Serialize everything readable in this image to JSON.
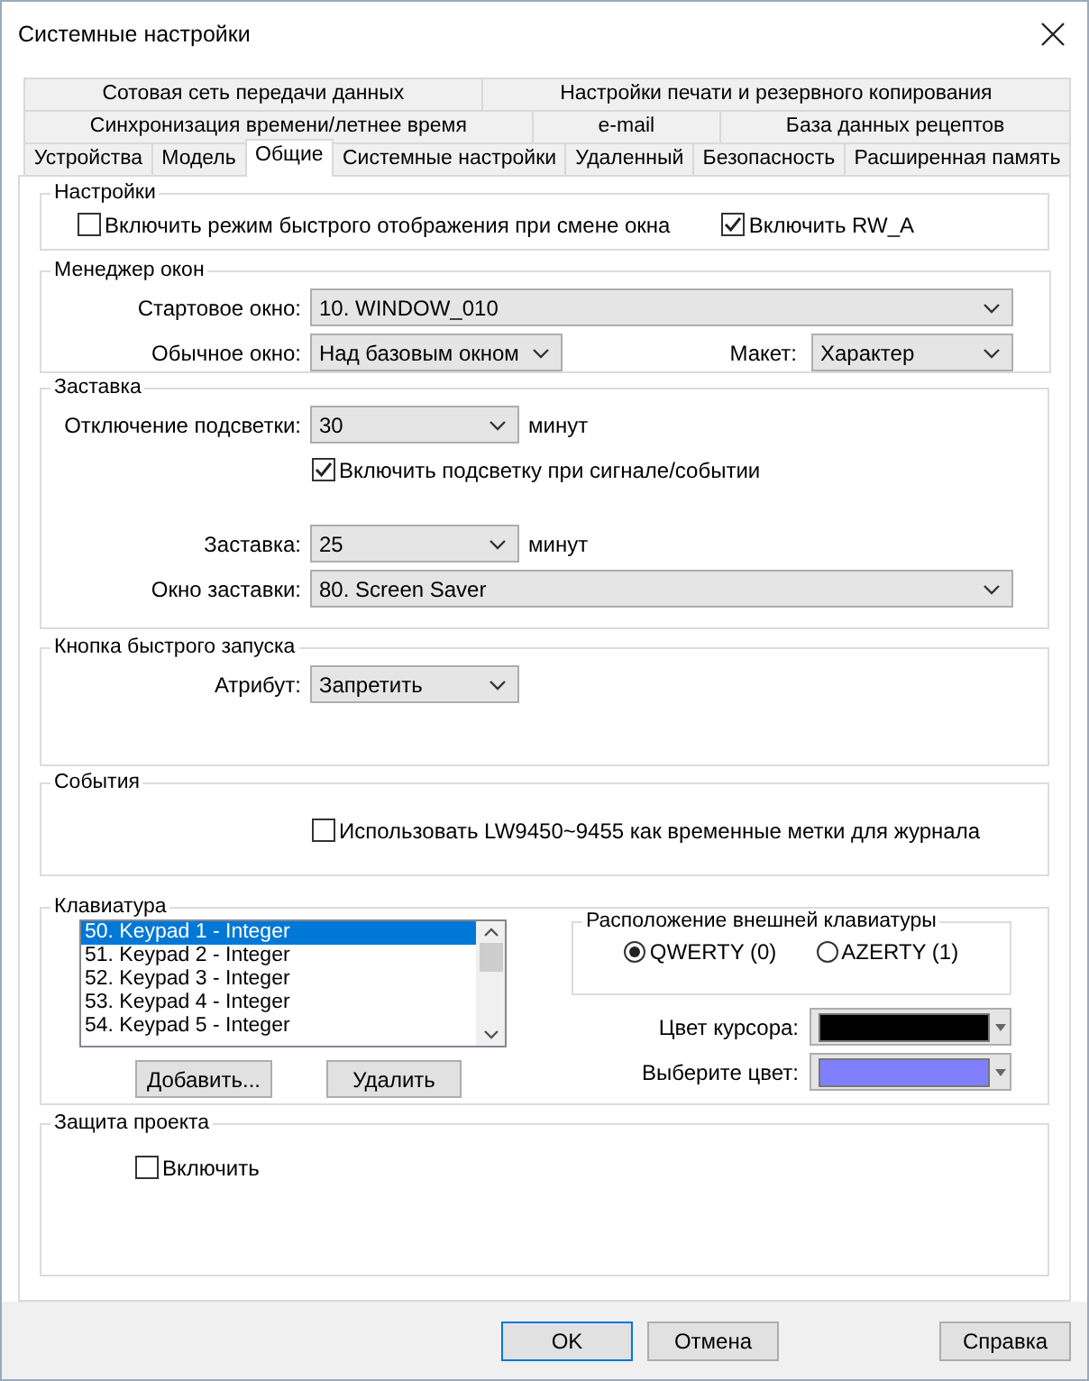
{
  "window": {
    "title": "Системные настройки"
  },
  "tab_rows": [
    {
      "tabs": [
        {
          "label": "Сотовая сеть передачи данных",
          "selected": false
        },
        {
          "label": "Настройки печати и резервного копирования",
          "selected": false
        }
      ]
    },
    {
      "tabs": [
        {
          "label": "Синхронизация времени/летнее время",
          "selected": false
        },
        {
          "label": "e-mail",
          "selected": false
        },
        {
          "label": "База данных рецептов",
          "selected": false
        }
      ]
    },
    {
      "tabs": [
        {
          "label": "Устройства",
          "selected": false
        },
        {
          "label": "Модель",
          "selected": false
        },
        {
          "label": "Общие",
          "selected": true
        },
        {
          "label": "Системные настройки",
          "selected": false
        },
        {
          "label": "Удаленный",
          "selected": false
        },
        {
          "label": "Безопасность",
          "selected": false
        },
        {
          "label": "Расширенная память",
          "selected": false
        }
      ]
    }
  ],
  "settings": {
    "title": "Настройки",
    "fast_display": {
      "label": "Включить режим быстрого отображения при смене окна",
      "checked": false
    },
    "rw_a": {
      "label": "Включить RW_A",
      "checked": true
    }
  },
  "window_manager": {
    "title": "Менеджер окон",
    "start_window": {
      "label": "Стартовое окно:",
      "value": "10. WINDOW_010"
    },
    "normal_window": {
      "label": "Обычное окно:",
      "value": "Над базовым окном"
    },
    "layout": {
      "label": "Макет:",
      "value": "Характер"
    }
  },
  "screensaver": {
    "title": "Заставка",
    "backlight_off": {
      "label": "Отключение подсветки:",
      "value": "30",
      "unit": "минут"
    },
    "backlight_on_event": {
      "label": "Включить подсветку при сигнале/событии",
      "checked": true
    },
    "screensaver": {
      "label": "Заставка:",
      "value": "25",
      "unit": "минут"
    },
    "screensaver_window": {
      "label": "Окно заставки:",
      "value": "80. Screen Saver"
    }
  },
  "quick_launch": {
    "title": "Кнопка быстрого запуска",
    "attribute": {
      "label": "Атрибут:",
      "value": "Запретить"
    }
  },
  "events": {
    "title": "События",
    "use_time_tags": {
      "label": "Использовать LW9450~9455 как временные метки для журнала",
      "checked": false
    }
  },
  "keyboard": {
    "title": "Клавиатура",
    "items": [
      {
        "label": "50. Keypad 1 - Integer",
        "selected": true
      },
      {
        "label": "51. Keypad 2 - Integer",
        "selected": false
      },
      {
        "label": "52. Keypad 3 - Integer",
        "selected": false
      },
      {
        "label": "53. Keypad 4 - Integer",
        "selected": false
      },
      {
        "label": "54. Keypad 5 - Integer",
        "selected": false
      }
    ],
    "add_button": "Добавить...",
    "delete_button": "Удалить",
    "external_layout": {
      "title": "Расположение внешней клавиатуры",
      "options": [
        {
          "label": "QWERTY (0)",
          "selected": true
        },
        {
          "label": "AZERTY (1)",
          "selected": false
        }
      ]
    },
    "cursor_color": {
      "label": "Цвет курсора:",
      "color": "#000000"
    },
    "select_color": {
      "label": "Выберите цвет:",
      "color": "#8080ff"
    }
  },
  "protection": {
    "title": "Защита проекта",
    "enable": {
      "label": "Включить",
      "checked": false
    }
  },
  "buttons": [
    {
      "label": "OK"
    },
    {
      "label": "Отмена"
    },
    {
      "label": "Справка"
    }
  ]
}
